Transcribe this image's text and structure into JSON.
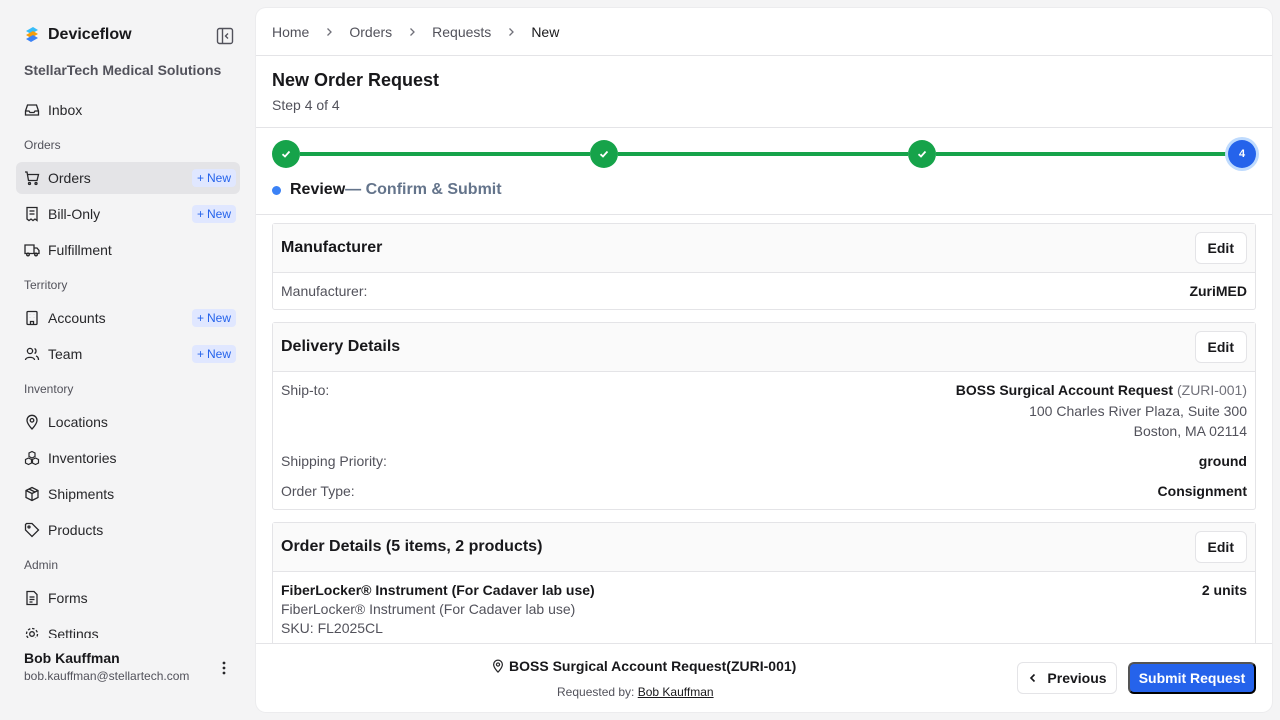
{
  "app": {
    "name": "Deviceflow",
    "org": "StellarTech Medical Solutions"
  },
  "sidebar": {
    "inbox": "Inbox",
    "sections": {
      "orders": "Orders",
      "territory": "Territory",
      "inventory": "Inventory",
      "admin": "Admin"
    },
    "items": {
      "orders": "Orders",
      "bill_only": "Bill-Only",
      "fulfillment": "Fulfillment",
      "accounts": "Accounts",
      "team": "Team",
      "locations": "Locations",
      "inventories": "Inventories",
      "shipments": "Shipments",
      "products": "Products",
      "forms": "Forms",
      "settings": "Settings"
    },
    "new_label": "New"
  },
  "user": {
    "name": "Bob Kauffman",
    "email": "bob.kauffman@stellartech.com"
  },
  "breadcrumb": {
    "home": "Home",
    "orders": "Orders",
    "requests": "Requests",
    "current": "New"
  },
  "page": {
    "title": "New Order Request",
    "step": "Step 4 of 4"
  },
  "stepper": {
    "current_number": "4",
    "current_name": "Review",
    "current_desc": "— Confirm & Submit"
  },
  "manufacturer": {
    "title": "Manufacturer",
    "edit": "Edit",
    "label": "Manufacturer:",
    "value": "ZuriMED"
  },
  "delivery": {
    "title": "Delivery Details",
    "edit": "Edit",
    "ship_to_label": "Ship-to:",
    "ship_to_name": "BOSS Surgical Account Request",
    "ship_to_code": "(ZURI-001)",
    "address_line1": "100 Charles River Plaza, Suite 300",
    "address_line2": "Boston, MA 02114",
    "priority_label": "Shipping Priority:",
    "priority_value": "ground",
    "order_type_label": "Order Type:",
    "order_type_value": "Consignment"
  },
  "order_details": {
    "title": "Order Details (5 items, 2 products)",
    "edit": "Edit",
    "item_name": "FiberLocker® Instrument (For Cadaver lab use)",
    "item_desc": "FiberLocker® Instrument (For Cadaver lab use)",
    "item_sku": "SKU: FL2025CL",
    "item_qty": "2 units"
  },
  "footer": {
    "account": "BOSS Surgical Account Request(ZURI-001)",
    "requested_by_label": "Requested by:",
    "requested_by_name": "Bob Kauffman",
    "previous": "Previous",
    "submit": "Submit Request"
  },
  "colors": {
    "accent": "#2563eb",
    "complete": "#16a34a"
  }
}
